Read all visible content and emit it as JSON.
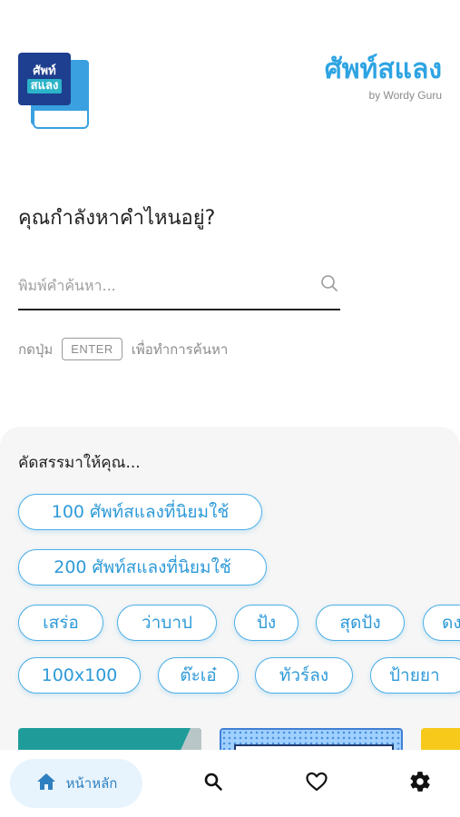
{
  "header": {
    "logo": {
      "line1": "ศัพท์",
      "line2": "สแลง"
    },
    "title": "ศัพท์สแลง",
    "subtitle": "by Wordy Guru"
  },
  "search": {
    "question": "คุณกำลังหาคำไหนอยู่?",
    "placeholder": "พิมพ์คำค้นหา...",
    "value": "",
    "icon": "search-icon",
    "hint_before": "กดปุ่ม",
    "hint_key": "ENTER",
    "hint_after": "เพื่อทำการค้นหา"
  },
  "recommend": {
    "title": "คัดสรรมาให้คุณ...",
    "collections": [
      {
        "label": "100 ศัพท์สแลงที่นิยมใช้"
      },
      {
        "label": "200 ศัพท์สแลงที่นิยมใช้"
      }
    ],
    "row1": [
      {
        "label": "เสร่อ"
      },
      {
        "label": "ว่าบาป"
      },
      {
        "label": "ปัง"
      },
      {
        "label": "สุดปัง"
      },
      {
        "label": "ดง"
      }
    ],
    "row2": [
      {
        "label": "100x100"
      },
      {
        "label": "ต๊ะเอ๋"
      },
      {
        "label": "ทัวร์ลง"
      },
      {
        "label": "ป้ายยา"
      }
    ]
  },
  "nav": {
    "home_label": "หน้าหลัก",
    "active": "home",
    "icons": [
      "home-icon",
      "search-icon",
      "heart-icon",
      "gear-icon"
    ]
  },
  "colors": {
    "accent": "#2ea4e3",
    "chip_border": "#4aaee6",
    "panel_bg": "#f6f6f6",
    "logo_navy": "#1e3f8f",
    "nav_active_bg": "#e8f4fd"
  }
}
